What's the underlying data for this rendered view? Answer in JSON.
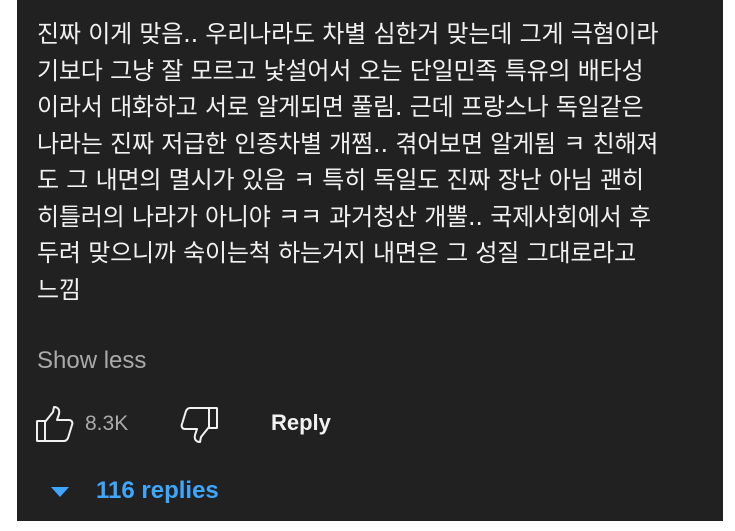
{
  "comment": {
    "text": "진짜 이게 맞음.. 우리나라도 차별 심한거 맞는데 그게 극혐이라\n기보다 그냥 잘 모르고 낯설어서 오는 단일민족 특유의 배타성\n이라서 대화하고 서로 알게되면 풀림. 근데 프랑스나 독일같은\n나라는 진짜 저급한 인종차별 개쩜.. 겪어보면 알게됨 ㅋ 친해져\n도 그 내면의 멸시가 있음 ㅋ 특히 독일도 진짜 장난 아님 괜히\n히틀러의 나라가 아니야 ㅋㅋ 과거청산 개뿔.. 국제사회에서 후\n두려 맞으니까 숙이는척 하는거지 내면은 그 성질 그대로라고\n느낌",
    "show_less_label": "Show less"
  },
  "actions": {
    "like_icon": "thumbs-up-icon",
    "like_count": "8.3K",
    "dislike_icon": "thumbs-down-icon",
    "reply_label": "Reply"
  },
  "replies": {
    "toggle_icon": "caret-down-icon",
    "label": "116 replies"
  },
  "colors": {
    "background": "#212121",
    "primary_text": "#f1f1f1",
    "secondary_text": "#aaaaaa",
    "link_blue": "#3ea6ff"
  }
}
